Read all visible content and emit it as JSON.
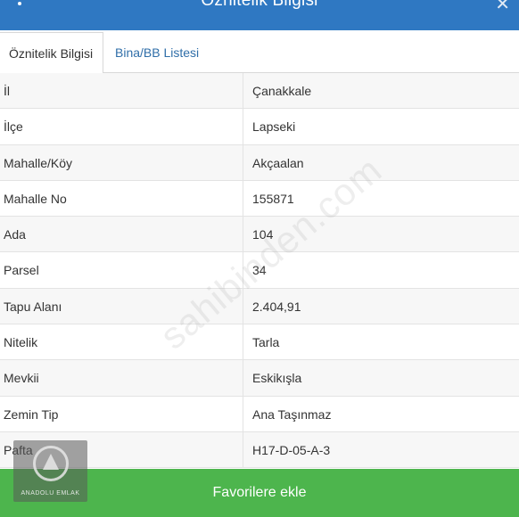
{
  "header": {
    "title": "Öznitelik Bilgisi",
    "menu_icon": "vertical-dots-icon",
    "close_icon": "close-icon",
    "close_glyph": "✕"
  },
  "tabs": [
    {
      "label": "Öznitelik Bilgisi",
      "active": true
    },
    {
      "label": "Bina/BB Listesi",
      "active": false
    }
  ],
  "attributes": [
    {
      "key": "İl",
      "value": "Çanakkale"
    },
    {
      "key": "İlçe",
      "value": "Lapseki"
    },
    {
      "key": "Mahalle/Köy",
      "value": "Akçaalan"
    },
    {
      "key": "Mahalle No",
      "value": "155871"
    },
    {
      "key": "Ada",
      "value": "104"
    },
    {
      "key": "Parsel",
      "value": "34"
    },
    {
      "key": "Tapu Alanı",
      "value": "2.404,91"
    },
    {
      "key": "Nitelik",
      "value": "Tarla"
    },
    {
      "key": "Mevkii",
      "value": "Eskikışla"
    },
    {
      "key": "Zemin Tip",
      "value": "Ana Taşınmaz"
    },
    {
      "key": "Pafta",
      "value": "H17-D-05-A-3"
    }
  ],
  "watermark": "sahibinden.com",
  "logo": {
    "text": "ANADOLU EMLAK"
  },
  "actions": {
    "favorite_label": "Favorilere ekle"
  },
  "colors": {
    "header_bg": "#2f78c2",
    "tab_link": "#2f6ea8",
    "favorite_bg": "#4db54d"
  }
}
